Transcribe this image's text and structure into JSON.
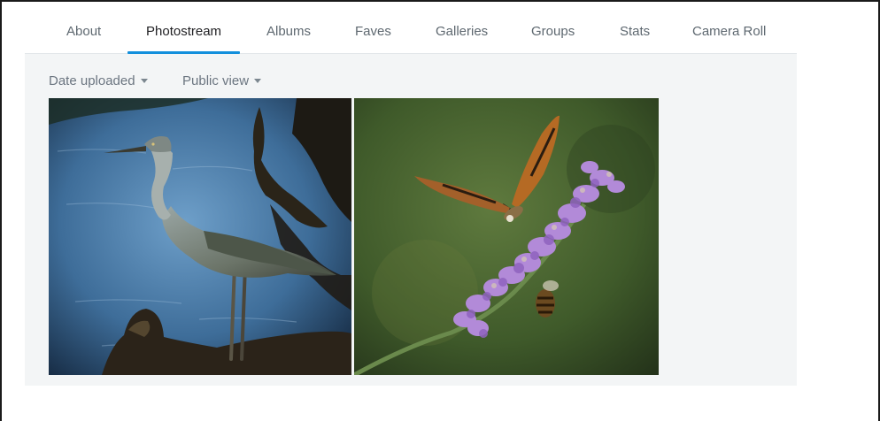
{
  "nav": {
    "tabs": [
      {
        "label": "About"
      },
      {
        "label": "Photostream",
        "active": true
      },
      {
        "label": "Albums"
      },
      {
        "label": "Faves"
      },
      {
        "label": "Galleries"
      },
      {
        "label": "Groups"
      },
      {
        "label": "Stats"
      },
      {
        "label": "Camera Roll"
      }
    ]
  },
  "filters": {
    "sort_label": "Date uploaded",
    "view_label": "Public view"
  },
  "colors": {
    "accent": "#128fdc",
    "panel_bg": "#f3f5f6",
    "tab_text": "#5e6870"
  },
  "photos": [
    {
      "subject": "heron-photo"
    },
    {
      "subject": "butterfly-lavender-photo"
    }
  ]
}
